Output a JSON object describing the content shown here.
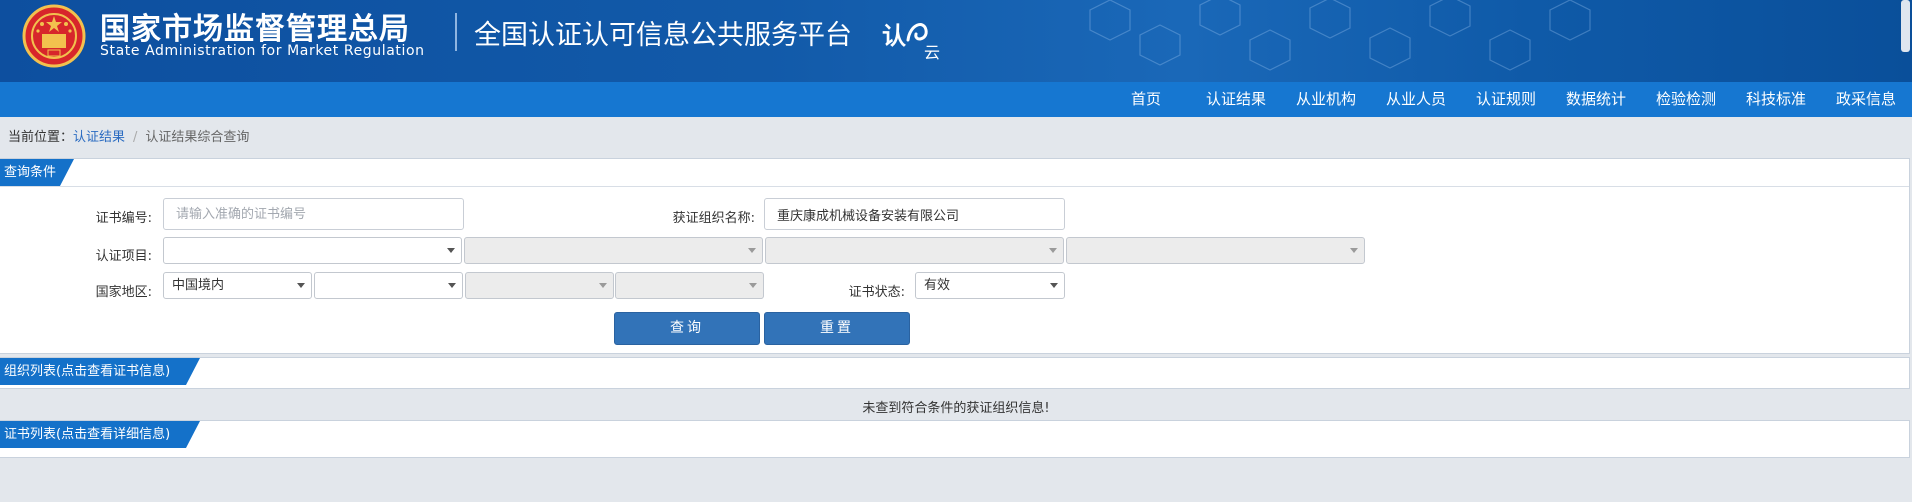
{
  "header": {
    "agency_cn": "国家市场监督管理总局",
    "agency_en": "State Administration  for  Market Regulation",
    "platform_name": "全国认证认可信息公共服务平台",
    "brand_logo_text": "认云",
    "colors": {
      "banner": "#125aa9",
      "nav": "#1677d1",
      "accent": "#1471c9"
    }
  },
  "nav": {
    "items": [
      "首页",
      "认证结果",
      "从业机构",
      "从业人员",
      "认证规则",
      "数据统计",
      "检验检测",
      "科技标准",
      "政采信息"
    ]
  },
  "breadcrumb": {
    "prefix": "当前位置：",
    "link": "认证结果",
    "separator": "/",
    "current": "认证结果综合查询"
  },
  "query": {
    "tab_title": "查询条件",
    "cert_no_label": "证书编号:",
    "cert_no_placeholder": "请输入准确的证书编号",
    "cert_no_value": "",
    "org_name_label": "获证组织名称:",
    "org_name_value": "重庆康成机械设备安装有限公司",
    "project_label": "认证项目:",
    "region_label": "国家地区:",
    "region_selected": "中国境内",
    "status_label": "证书状态:",
    "status_selected": "有效",
    "search_button": "查询",
    "reset_button": "重置"
  },
  "org_list": {
    "tab_title": "组织列表(点击查看证书信息)",
    "empty_message": "未查到符合条件的获证组织信息!"
  },
  "cert_list": {
    "tab_title": "证书列表(点击查看详细信息)"
  }
}
